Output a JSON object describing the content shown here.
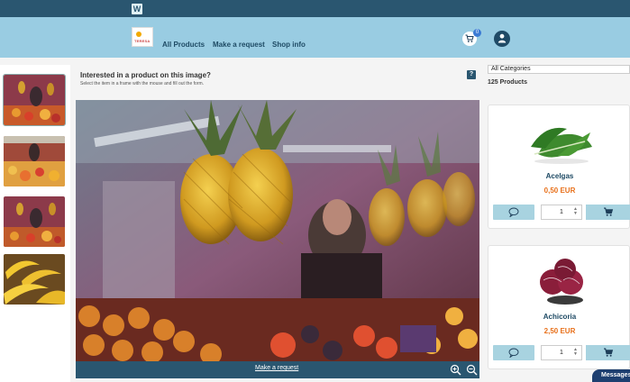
{
  "header": {
    "site_logo_letter": "W",
    "brand_text": "TERESA"
  },
  "nav": {
    "links": [
      {
        "label": "All Products"
      },
      {
        "label": "Make a request"
      },
      {
        "label": "Shop info"
      }
    ],
    "cart_count": "0"
  },
  "thumbnails": [
    {
      "label": "market-scene-1"
    },
    {
      "label": "market-scene-2"
    },
    {
      "label": "market-scene-3"
    },
    {
      "label": "bananas"
    }
  ],
  "viewer": {
    "title": "Interested in a product on this image?",
    "subtitle": "Select the item in a frame with the mouse and fill out the form.",
    "help_label": "?",
    "request_link": "Make a request"
  },
  "catalog": {
    "category_select": "All Categories",
    "product_count": "125 Products",
    "products": [
      {
        "name": "Acelgas",
        "price": "0,50 EUR",
        "quantity": "1"
      },
      {
        "name": "Achicoria",
        "price": "2,50 EUR",
        "quantity": "1"
      }
    ]
  },
  "chat": {
    "label": "Messages"
  },
  "colors": {
    "topbar": "#2a5670",
    "nav": "#99cce2",
    "accent_price": "#e8701a",
    "button": "#a8d3e0"
  }
}
